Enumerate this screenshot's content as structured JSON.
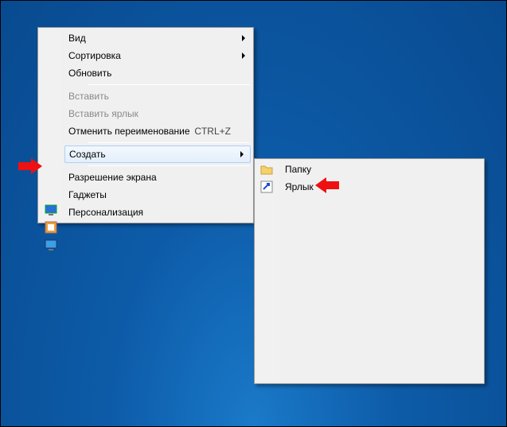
{
  "main_menu": {
    "view": "Вид",
    "sort": "Сортировка",
    "refresh": "Обновить",
    "paste": "Вставить",
    "paste_shortcut": "Вставить ярлык",
    "undo_rename": "Отменить переименование",
    "undo_hint": "CTRL+Z",
    "create": "Создать",
    "screen_res": "Разрешение экрана",
    "gadgets": "Гаджеты",
    "personalize": "Персонализация"
  },
  "sub_menu": {
    "folder": "Папку",
    "shortcut": "Ярлык"
  }
}
